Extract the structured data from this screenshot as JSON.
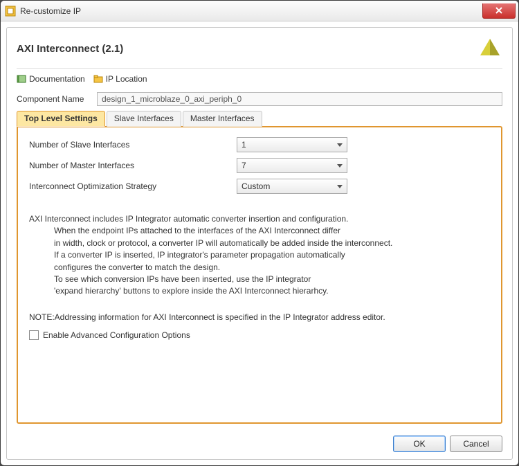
{
  "window": {
    "title": "Re-customize IP"
  },
  "header": {
    "heading": "AXI Interconnect (2.1)"
  },
  "toolbar": {
    "documentation": "Documentation",
    "ip_location": "IP Location"
  },
  "component_name": {
    "label": "Component Name",
    "value": "design_1_microblaze_0_axi_periph_0"
  },
  "tabs": [
    {
      "label": "Top Level Settings",
      "active": true
    },
    {
      "label": "Slave Interfaces",
      "active": false
    },
    {
      "label": "Master Interfaces",
      "active": false
    }
  ],
  "settings": {
    "num_slave_label": "Number of Slave Interfaces",
    "num_slave_value": "1",
    "num_master_label": "Number of Master Interfaces",
    "num_master_value": "7",
    "opt_strategy_label": "Interconnect Optimization Strategy",
    "opt_strategy_value": "Custom"
  },
  "description": {
    "intro": "AXI Interconnect includes IP Integrator automatic converter insertion and configuration.",
    "lines": [
      "When the endpoint IPs attached to the interfaces of the AXI Interconnect differ",
      "in width, clock or protocol, a converter IP will automatically be added inside the interconnect.",
      "If a converter IP is inserted, IP integrator's parameter propagation automatically",
      "configures the converter to match the design.",
      "To see which conversion IPs have been inserted, use the IP integrator",
      "'expand hierarchy' buttons to explore inside the AXI Interconnect hierarhcy."
    ],
    "note": "NOTE:Addressing information for AXI Interconnect is specified in the IP Integrator address editor."
  },
  "advanced_checkbox": {
    "label": "Enable Advanced Configuration Options",
    "checked": false
  },
  "buttons": {
    "ok": "OK",
    "cancel": "Cancel"
  }
}
